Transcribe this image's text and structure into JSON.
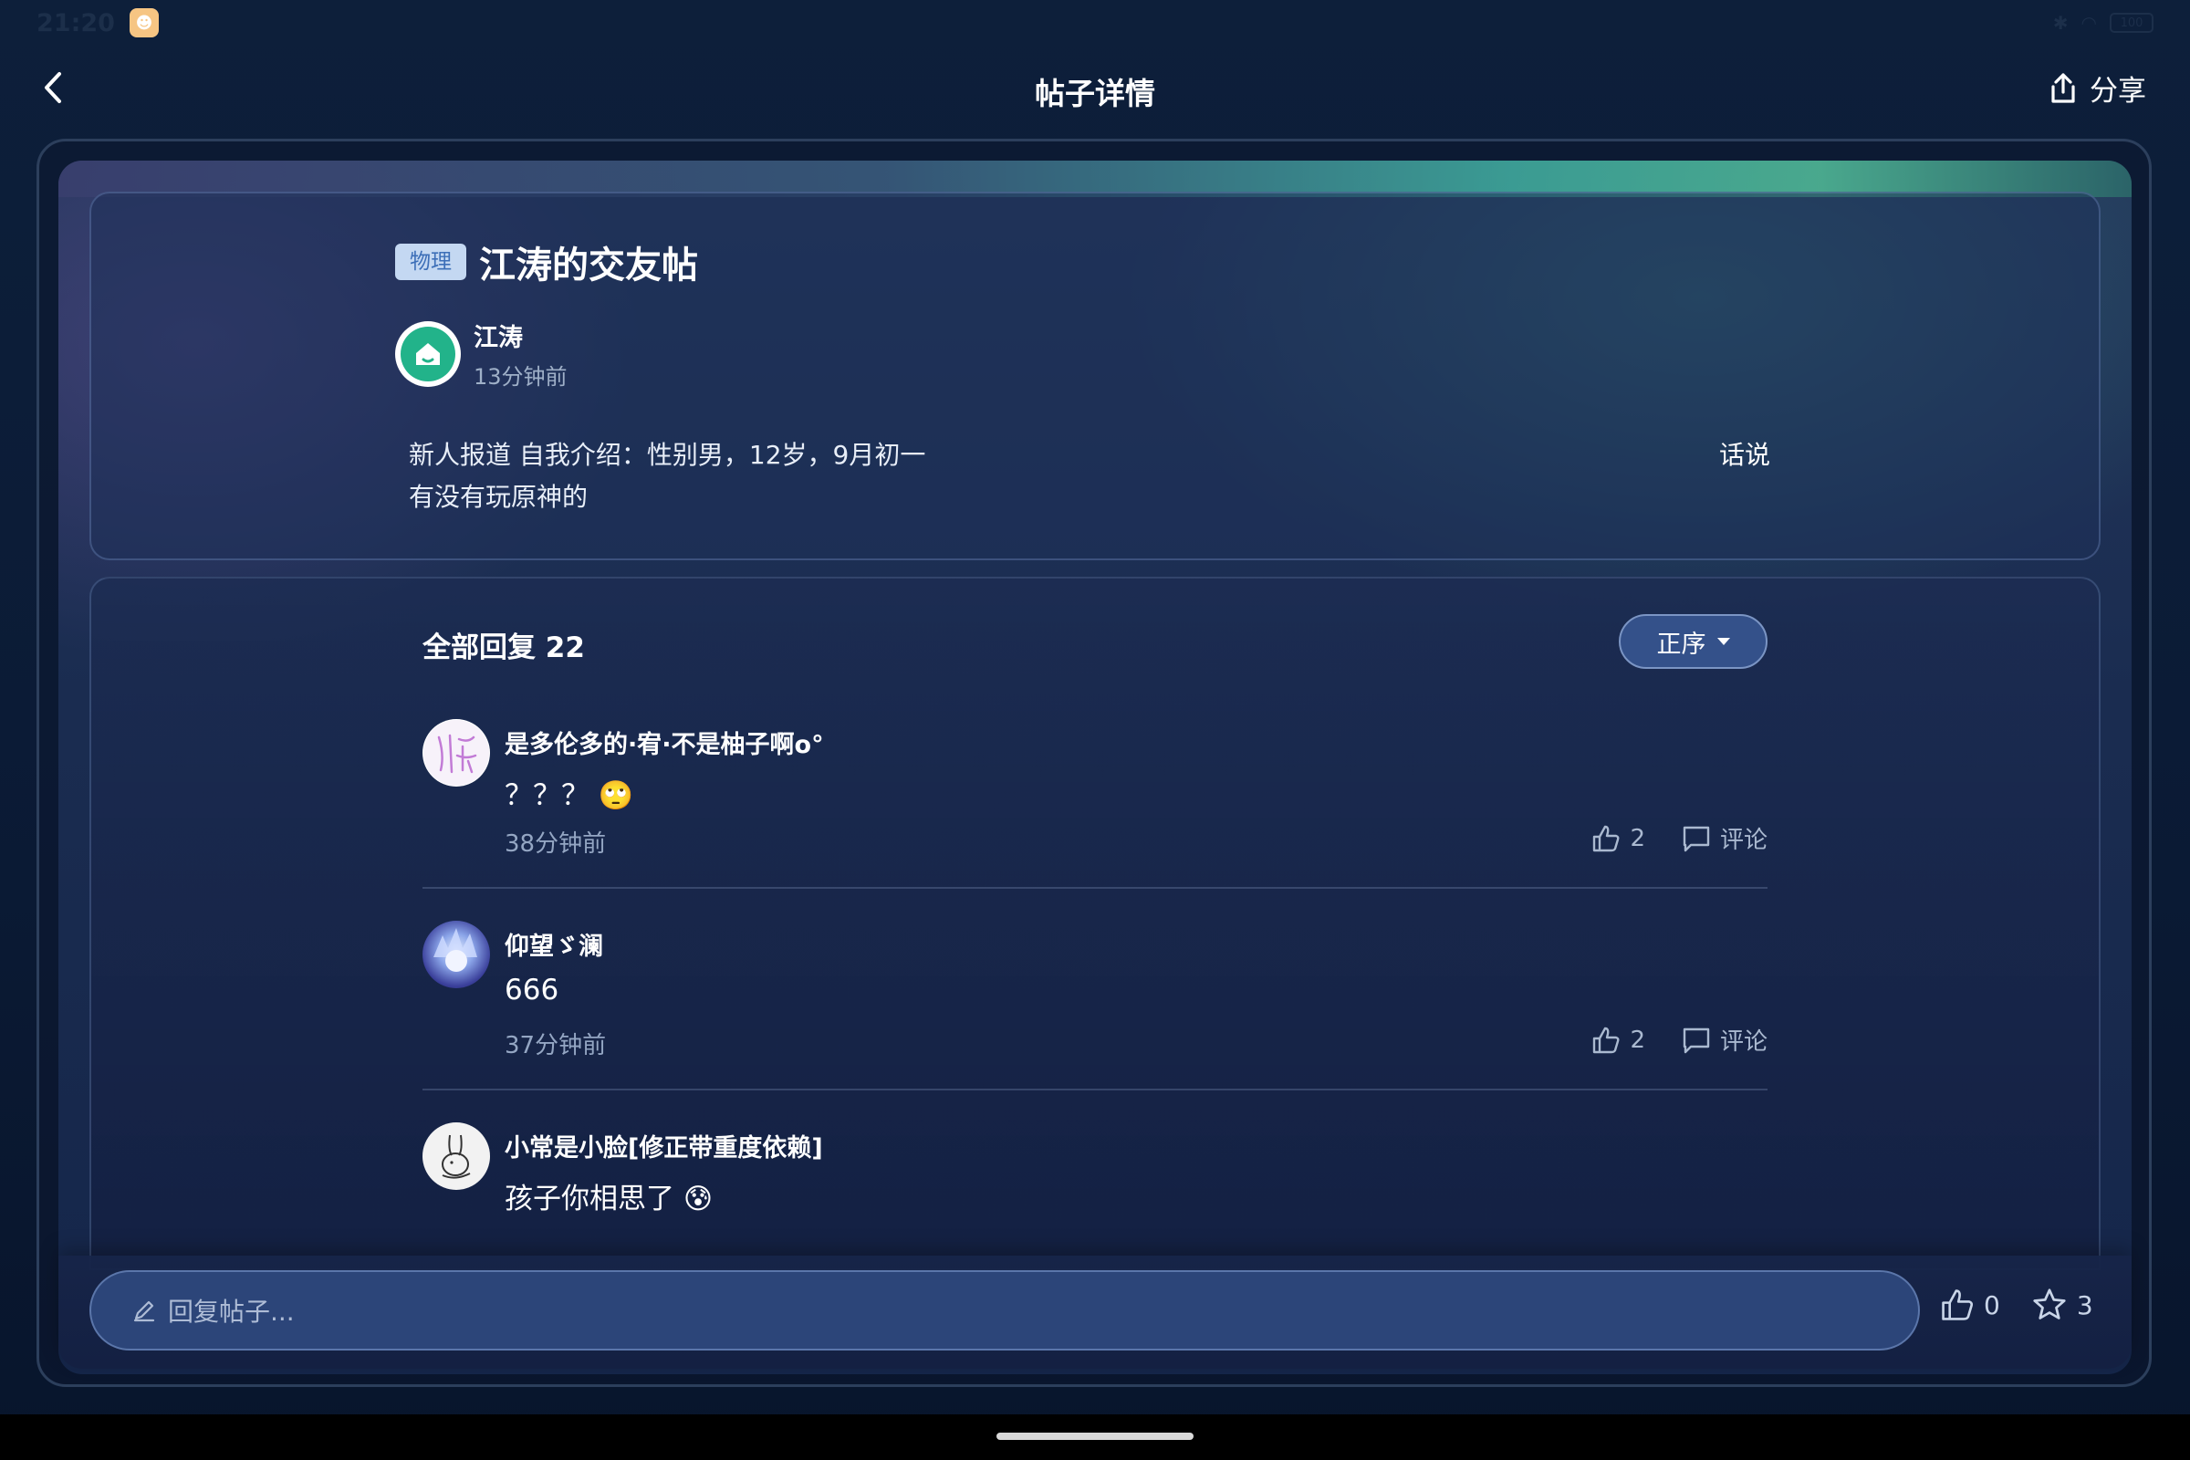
{
  "status_bar": {
    "time": "21:20",
    "battery": "100"
  },
  "nav": {
    "title": "帖子详情",
    "share_label": "分享"
  },
  "post": {
    "category_tag": "物理",
    "title": "江涛的交友帖",
    "author": {
      "name": "江涛",
      "time": "13分钟前"
    },
    "body_lines": [
      "新人报道 自我介绍：性别男，12岁，9月初一",
      "有没有玩原神的"
    ],
    "side_text": "话说"
  },
  "replies": {
    "header": "全部回复 22",
    "sort_label": "正序",
    "items": [
      {
        "name": "是多伦多的·宥·不是柚子啊o°",
        "content": "？？？",
        "emoji": "🙄",
        "time": "38分钟前",
        "likes": "2",
        "comment_label": "评论"
      },
      {
        "name": "仰望ゞ澜",
        "content": "666",
        "emoji": "",
        "time": "37分钟前",
        "likes": "2",
        "comment_label": "评论"
      },
      {
        "name": "小常是小脸[修正带重度依赖]",
        "content": "孩子你相思了",
        "emoji": "😰",
        "time": "",
        "likes": "",
        "comment_label": ""
      }
    ]
  },
  "bottom_bar": {
    "reply_placeholder": "回复帖子...",
    "like_count": "0",
    "favorite_count": "3"
  },
  "colors": {
    "accent_tag_bg": "#c4d8f2",
    "accent_tag_text": "#3d6fb8",
    "author_avatar": "#22b38a",
    "sort_button": "#34518a"
  }
}
